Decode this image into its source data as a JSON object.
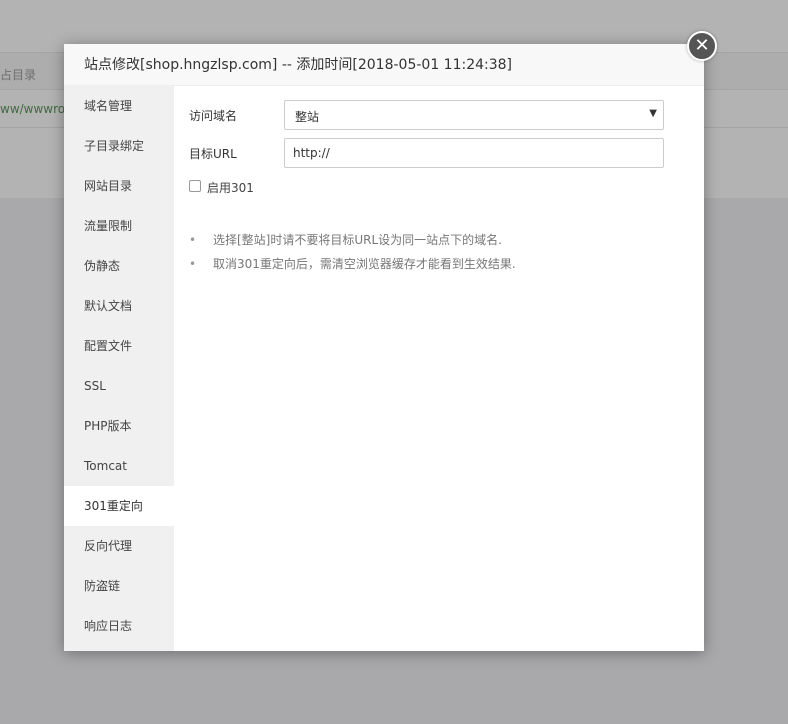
{
  "background": {
    "header_cell": "占目录",
    "data_cell": "ww/wwwroo"
  },
  "modal": {
    "title": "站点修改[shop.hngzlsp.com] -- 添加时间[2018-05-01 11:24:38]",
    "close_glyph": "✕"
  },
  "sidebar": {
    "items": [
      {
        "label": "域名管理"
      },
      {
        "label": "子目录绑定"
      },
      {
        "label": "网站目录"
      },
      {
        "label": "流量限制"
      },
      {
        "label": "伪静态"
      },
      {
        "label": "默认文档"
      },
      {
        "label": "配置文件"
      },
      {
        "label": "SSL"
      },
      {
        "label": "PHP版本"
      },
      {
        "label": "Tomcat"
      },
      {
        "label": "301重定向"
      },
      {
        "label": "反向代理"
      },
      {
        "label": "防盗链"
      },
      {
        "label": "响应日志"
      }
    ],
    "active_index": 10
  },
  "form": {
    "domain_label": "访问域名",
    "domain_value": "整站",
    "target_label": "目标URL",
    "target_value": "http://",
    "enable_label": "启用301",
    "enable_checked": false
  },
  "tips": [
    "选择[整站]时请不要将目标URL设为同一站点下的域名.",
    "取消301重定向后，需清空浏览器缓存才能看到生效结果."
  ],
  "icons": {
    "close": "close-icon",
    "select_arrow": "caret-down-icon",
    "bullet": "bullet-icon"
  }
}
